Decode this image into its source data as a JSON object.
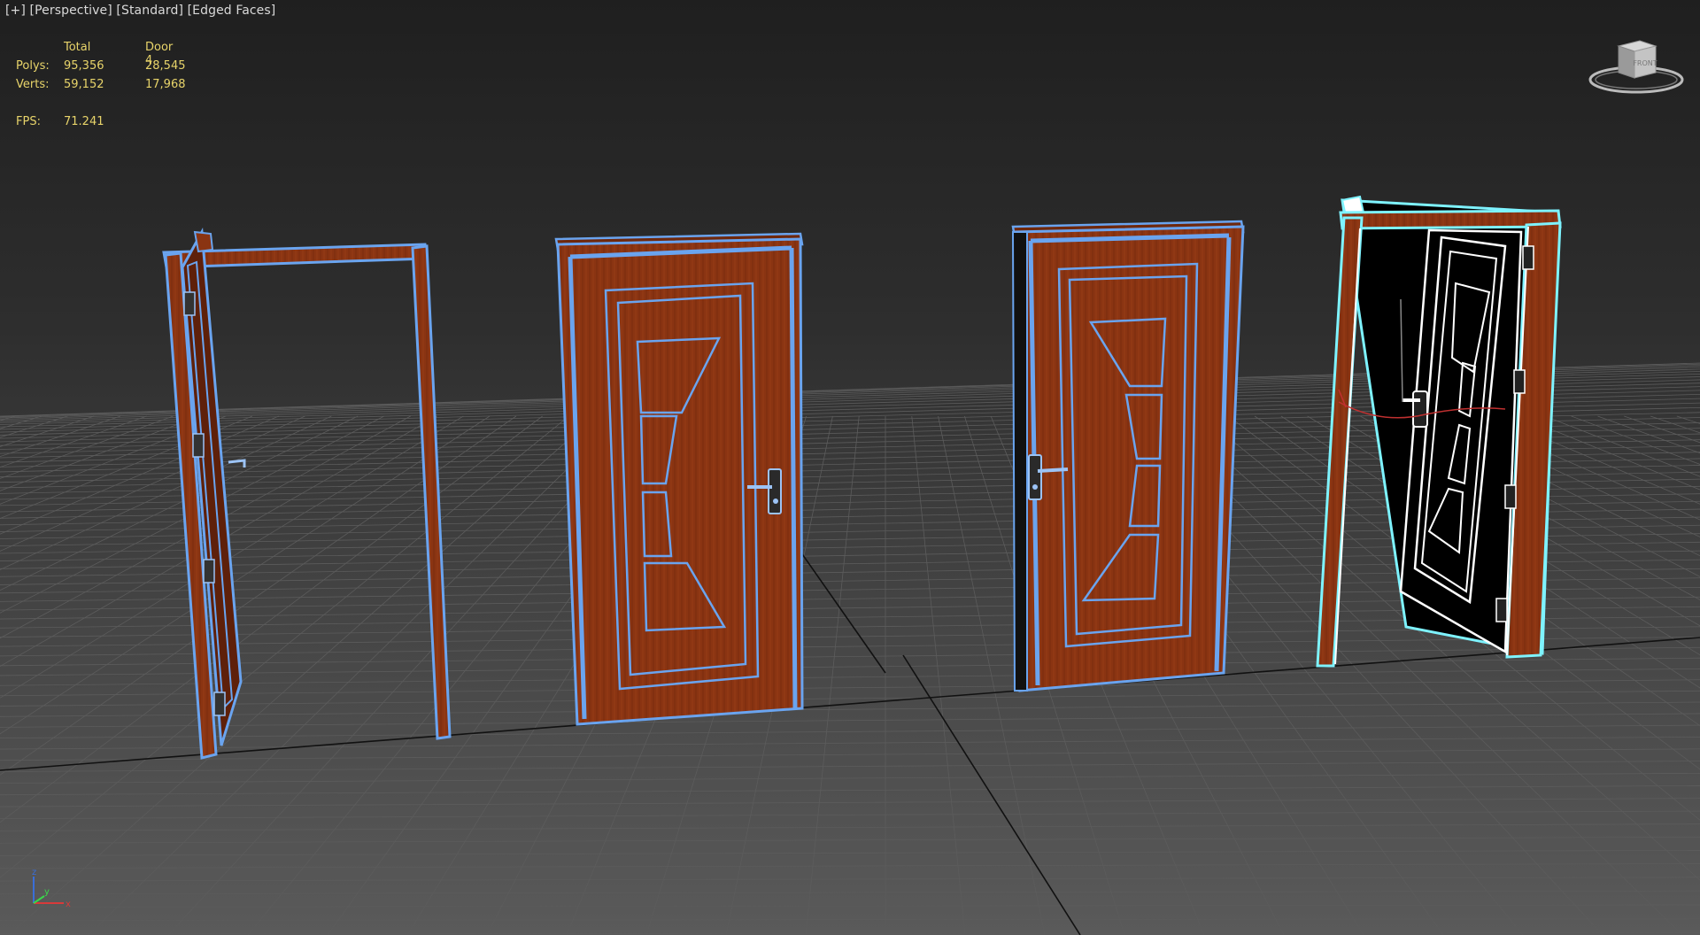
{
  "viewport": {
    "label_parts": [
      "[+]",
      "[Perspective]",
      "[Standard]",
      "[Edged Faces]"
    ],
    "stats": {
      "col_total": "Total",
      "col_selected": "Door 4",
      "polys_label": "Polys:",
      "polys_total": "95,356",
      "polys_selected": "28,545",
      "verts_label": "Verts:",
      "verts_total": "59,152",
      "verts_selected": "17,968",
      "fps_label": "FPS:",
      "fps_value": "71.241"
    },
    "viewcube": {
      "face_label": "FRONT",
      "icon": "viewcube-icon"
    },
    "axis_tripod": {
      "x": "x",
      "y": "y",
      "z": "z",
      "icon": "axis-tripod-icon"
    }
  },
  "scene": {
    "objects": [
      "door-1-open",
      "door-2-closed-handle-right",
      "door-3-closed-handle-left",
      "door-4-selected-open"
    ],
    "colors": {
      "wood": "#8a3412",
      "wood_dark": "#5e200a",
      "edge": "#6aa4ef",
      "selection": "#7ef3ff",
      "grid": "#5c5c5c",
      "stats_text": "#e8d46a"
    }
  }
}
